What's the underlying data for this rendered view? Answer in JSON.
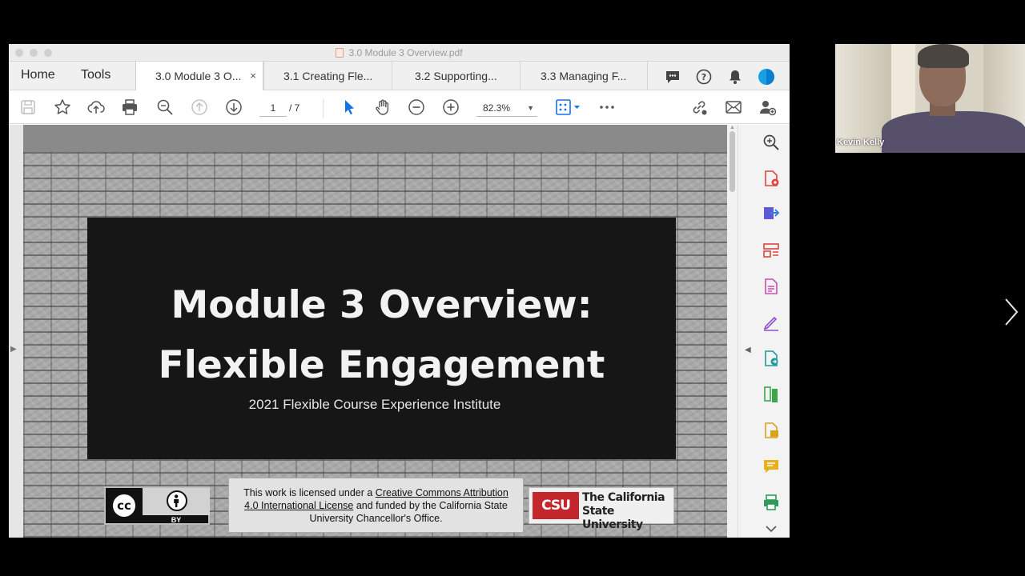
{
  "window": {
    "title": "3.0 Module 3 Overview.pdf"
  },
  "nav": {
    "home": "Home",
    "tools": "Tools"
  },
  "tabs": [
    {
      "label": "3.0 Module 3 O...",
      "close": "×"
    },
    {
      "label": "3.1 Creating Fle..."
    },
    {
      "label": "3.2 Supporting..."
    },
    {
      "label": "3.3 Managing F..."
    }
  ],
  "toolbar": {
    "page_current": "1",
    "page_total": "/ 7",
    "zoom": "82.3%"
  },
  "slide": {
    "title_line1": "Module 3 Overview:",
    "title_line2": "Flexible Engagement",
    "subtitle": "2021 Flexible Course Experience Institute",
    "cc_label": "cc",
    "by_label": "BY",
    "license_pre": "This work is licensed under a ",
    "license_link": "Creative Commons Attribution 4.0 International License",
    "license_post": " and funded by the California State University Chancellor's Office.",
    "csu_abbr": "CSU",
    "csu_name": "The California State University"
  },
  "participant": {
    "name": "Kevin Kelly"
  },
  "colors": {
    "accent": "#1473e6",
    "csu_red": "#c4262e"
  }
}
